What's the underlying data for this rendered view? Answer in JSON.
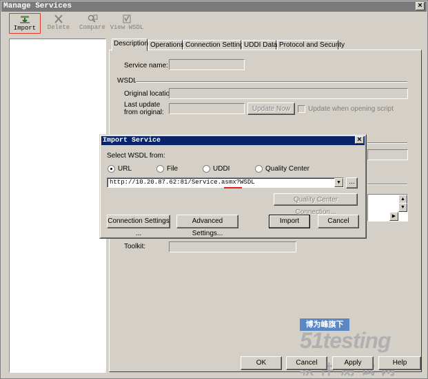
{
  "window": {
    "title": "Manage Services",
    "close": "×"
  },
  "toolbar": {
    "import": "Import",
    "delete": "Delete",
    "compare": "Compare",
    "view_wsdl": "View WSDL"
  },
  "tabs": [
    "Description",
    "Operations",
    "Connection Settings",
    "UDDI Data",
    "Protocol and Security"
  ],
  "description": {
    "service_name_label": "Service name:",
    "wsdl_group": "WSDL",
    "original_location_label": "Original location:",
    "last_update_label_1": "Last update",
    "last_update_label_2": "from original:",
    "update_now": "Update Now",
    "update_when_opening": "Update when opening script",
    "toolkit_label": "Toolkit:"
  },
  "import_dialog": {
    "title": "Import Service",
    "close": "×",
    "select_from": "Select WSDL from:",
    "options": [
      "URL",
      "File",
      "UDDI",
      "Quality Center"
    ],
    "selected_option": "URL",
    "url_value": "http://10.20.87.62:81/Service.asmx?WSDL",
    "browse": "...",
    "qc_connection": "Quality Center Connection...",
    "connection_settings": "Connection Settings ...",
    "advanced_settings": "Advanced Settings...",
    "import": "Import",
    "cancel": "Cancel"
  },
  "footer": {
    "ok": "OK",
    "cancel": "Cancel",
    "apply": "Apply",
    "help": "Help"
  },
  "watermark": {
    "line1": "博为峰旗下",
    "line2": "51testing",
    "line3": "软 件 测 试 网"
  },
  "colors": {
    "accent_red": "#e03a2a",
    "dialog_title": "#0a246a",
    "watermark_orange": "#f39a1e"
  }
}
